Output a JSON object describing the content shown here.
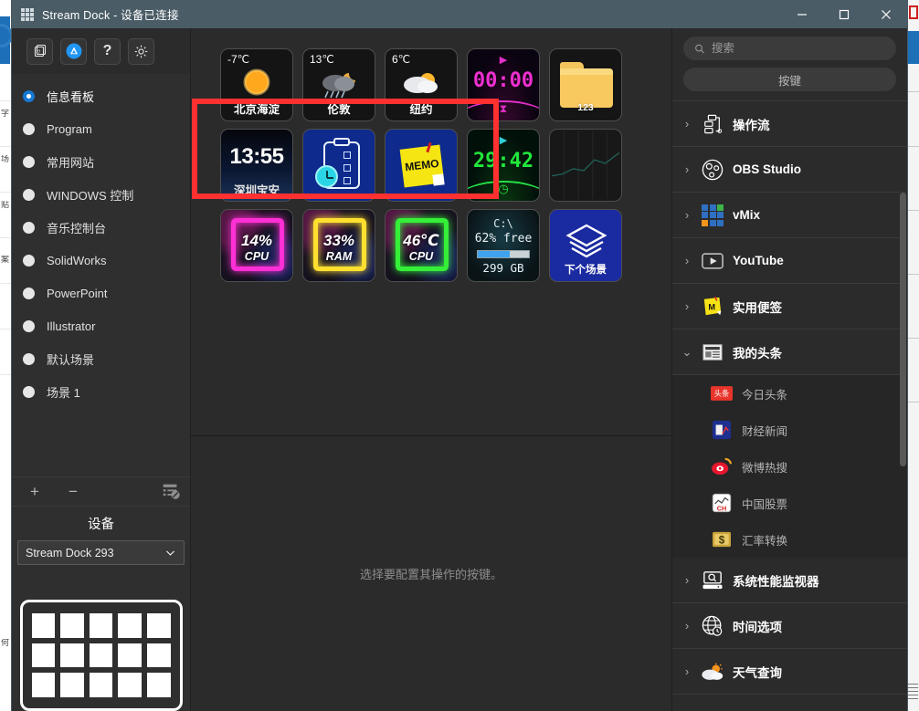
{
  "window": {
    "title": "Stream Dock - 设备已连接",
    "minimize": "minimize",
    "maximize": "maximize",
    "close": "close"
  },
  "toolbar": {
    "buttons": [
      {
        "name": "profiles-copy-button",
        "icon": "stacked-cards-icon"
      },
      {
        "name": "store-button",
        "icon": "app-store-icon"
      },
      {
        "name": "help-button",
        "icon": "question-mark-icon",
        "label": "?"
      },
      {
        "name": "settings-button",
        "icon": "gear-icon"
      }
    ]
  },
  "sidebar": {
    "profiles": [
      {
        "label": "信息看板",
        "active": true
      },
      {
        "label": "Program",
        "active": false
      },
      {
        "label": "常用网站",
        "active": false
      },
      {
        "label": "WINDOWS 控制",
        "active": false
      },
      {
        "label": "音乐控制台",
        "active": false
      },
      {
        "label": "SolidWorks",
        "active": false
      },
      {
        "label": "PowerPoint",
        "active": false
      },
      {
        "label": "Illustrator",
        "active": false
      },
      {
        "label": "默认场景",
        "active": false
      },
      {
        "label": "场景 1",
        "active": false
      }
    ],
    "actions": {
      "add": "+",
      "remove": "−",
      "manage_icon": "server-list-icon"
    },
    "device": {
      "title": "设备",
      "selected": "Stream Dock 293",
      "chevron": "chevron-down-icon",
      "preview_rows": 3,
      "preview_cols": 5
    }
  },
  "keygrid": {
    "hint": "选择要配置其操作的按键。",
    "selection_highlight_color": "#ff3030",
    "rows": [
      [
        {
          "type": "weather",
          "temp": "-7℃",
          "city": "北京海淀",
          "glyph": "☀",
          "icon": "sun-icon"
        },
        {
          "type": "weather",
          "temp": "13℃",
          "city": "伦敦",
          "glyph": "🌧",
          "icon": "rain-night-icon"
        },
        {
          "type": "weather",
          "temp": "6℃",
          "city": "纽约",
          "glyph": "⛅",
          "icon": "partly-cloudy-icon"
        },
        {
          "type": "timer",
          "value": "00:00",
          "color": "#ef2fd0",
          "icon": "hourglass-icon"
        },
        {
          "type": "folder",
          "name": "123",
          "icon": "folder-icon"
        }
      ],
      [
        {
          "type": "clock",
          "time": "13:55",
          "location": "深圳宝安"
        },
        {
          "type": "todo",
          "icon": "clipboard-clock-icon"
        },
        {
          "type": "memo",
          "text": "MEMO",
          "icon": "sticky-note-icon"
        },
        {
          "type": "timer",
          "value": "29:42",
          "color": "#22e83c",
          "icon": "stopwatch-icon"
        },
        {
          "type": "chart",
          "icon": "line-chart-icon"
        }
      ],
      [
        {
          "type": "monitor",
          "value": "14%",
          "label": "CPU",
          "color": "#ff2fd6"
        },
        {
          "type": "monitor",
          "value": "33%",
          "label": "RAM",
          "color": "#ffe02f"
        },
        {
          "type": "monitor",
          "value": "46℃",
          "label": "CPU",
          "color": "#35ef38"
        },
        {
          "type": "disk",
          "drive": "C:\\",
          "free_text": "62% free",
          "capacity": "299 GB",
          "free_percent": 62
        },
        {
          "type": "scene",
          "label": "下个场景",
          "icon": "layers-icon"
        }
      ]
    ]
  },
  "rightpanel": {
    "search_placeholder": "搜索",
    "search_value": "",
    "search_icon": "search-icon",
    "key_tab_label": "按键",
    "plugins": [
      {
        "name": "操作流",
        "icon": "workflow-icon",
        "expanded": false
      },
      {
        "name": "OBS Studio",
        "icon": "obs-icon",
        "expanded": false
      },
      {
        "name": "vMix",
        "icon": "vmix-icon",
        "expanded": false
      },
      {
        "name": "YouTube",
        "icon": "youtube-icon",
        "expanded": false
      },
      {
        "name": "实用便签",
        "icon": "sticky-note-icon",
        "expanded": false
      },
      {
        "name": "我的头条",
        "icon": "newspaper-icon",
        "expanded": true,
        "children": [
          {
            "name": "今日头条",
            "icon": "toutiao-icon"
          },
          {
            "name": "财经新闻",
            "icon": "finance-news-icon"
          },
          {
            "name": "微博热搜",
            "icon": "weibo-icon"
          },
          {
            "name": "中国股票",
            "icon": "china-stock-icon"
          },
          {
            "name": "汇率转换",
            "icon": "currency-exchange-icon"
          }
        ]
      },
      {
        "name": "系统性能监视器",
        "icon": "monitor-search-icon",
        "expanded": false
      },
      {
        "name": "时间选项",
        "icon": "globe-clock-icon",
        "expanded": false
      },
      {
        "name": "天气查询",
        "icon": "weather-icon",
        "expanded": false
      }
    ]
  }
}
